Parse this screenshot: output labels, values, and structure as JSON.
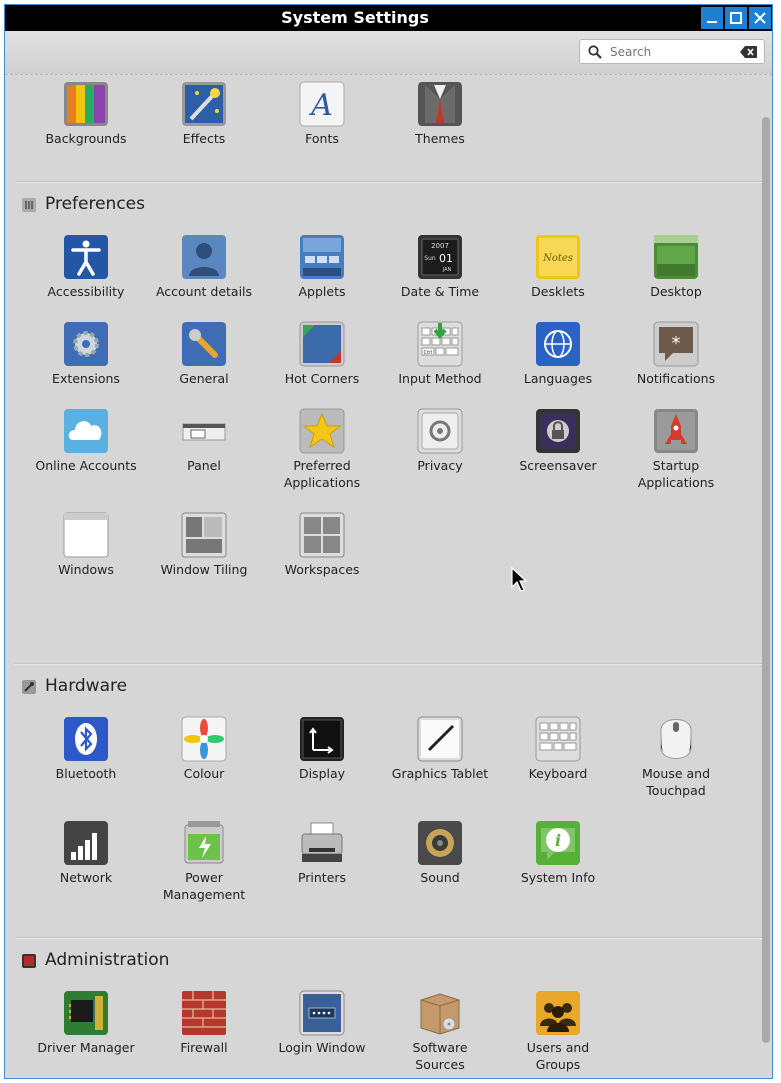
{
  "window": {
    "title": "System Settings",
    "minimize": "🗕",
    "maximize": "🗖",
    "close": "✕"
  },
  "search": {
    "placeholder": "Search",
    "value": ""
  },
  "appearance": {
    "items": [
      {
        "label": "Backgrounds",
        "icon": "backgrounds-icon"
      },
      {
        "label": "Effects",
        "icon": "effects-icon"
      },
      {
        "label": "Fonts",
        "icon": "fonts-icon"
      },
      {
        "label": "Themes",
        "icon": "themes-icon"
      }
    ]
  },
  "preferences": {
    "title": "Preferences",
    "items": [
      {
        "label": "Accessibility",
        "icon": "accessibility-icon"
      },
      {
        "label": "Account details",
        "icon": "account-icon"
      },
      {
        "label": "Applets",
        "icon": "applets-icon"
      },
      {
        "label": "Date & Time",
        "icon": "clock-icon",
        "cal_year": "2007",
        "cal_day": "Sun",
        "cal_date": "01",
        "cal_month": "JAN"
      },
      {
        "label": "Desklets",
        "icon": "desklets-icon",
        "note_text": "Notes"
      },
      {
        "label": "Desktop",
        "icon": "desktop-icon"
      },
      {
        "label": "Extensions",
        "icon": "extensions-icon"
      },
      {
        "label": "General",
        "icon": "general-icon"
      },
      {
        "label": "Hot Corners",
        "icon": "hot-corners-icon"
      },
      {
        "label": "Input Method",
        "icon": "input-method-icon",
        "key_label": "Ctrl"
      },
      {
        "label": "Languages",
        "icon": "languages-icon"
      },
      {
        "label": "Notifications",
        "icon": "notifications-icon"
      },
      {
        "label": "Online Accounts",
        "icon": "cloud-icon"
      },
      {
        "label": "Panel",
        "icon": "panel-icon"
      },
      {
        "label": "Preferred Applications",
        "line1": "Preferred",
        "line2": "Applications",
        "icon": "star-icon"
      },
      {
        "label": "Privacy",
        "icon": "privacy-icon"
      },
      {
        "label": "Screensaver",
        "icon": "lock-icon"
      },
      {
        "label": "Startup Applications",
        "line1": "Startup",
        "line2": "Applications",
        "icon": "rocket-icon"
      },
      {
        "label": "Windows",
        "icon": "windows-icon"
      },
      {
        "label": "Window Tiling",
        "icon": "window-tiling-icon"
      },
      {
        "label": "Workspaces",
        "icon": "workspaces-icon"
      }
    ]
  },
  "hardware": {
    "title": "Hardware",
    "items": [
      {
        "label": "Bluetooth",
        "icon": "bluetooth-icon"
      },
      {
        "label": "Colour",
        "icon": "colour-icon"
      },
      {
        "label": "Display",
        "icon": "display-icon"
      },
      {
        "label": "Graphics Tablet",
        "icon": "graphics-tablet-icon"
      },
      {
        "label": "Keyboard",
        "icon": "keyboard-icon"
      },
      {
        "label": "Mouse and Touchpad",
        "line1": "Mouse and",
        "line2": "Touchpad",
        "icon": "mouse-icon"
      },
      {
        "label": "Network",
        "icon": "network-icon"
      },
      {
        "label": "Power Management",
        "line1": "Power",
        "line2": "Management",
        "icon": "battery-icon"
      },
      {
        "label": "Printers",
        "icon": "printer-icon"
      },
      {
        "label": "Sound",
        "icon": "speaker-icon"
      },
      {
        "label": "System Info",
        "icon": "info-icon"
      }
    ]
  },
  "administration": {
    "title": "Administration",
    "items": [
      {
        "label": "Driver Manager",
        "icon": "chip-icon"
      },
      {
        "label": "Firewall",
        "icon": "firewall-icon"
      },
      {
        "label": "Login Window",
        "icon": "login-window-icon"
      },
      {
        "label": "Software Sources",
        "line1": "Software",
        "line2": "Sources",
        "icon": "package-icon"
      },
      {
        "label": "Users and Groups",
        "line1": "Users and",
        "line2": "Groups",
        "icon": "users-icon"
      }
    ]
  }
}
